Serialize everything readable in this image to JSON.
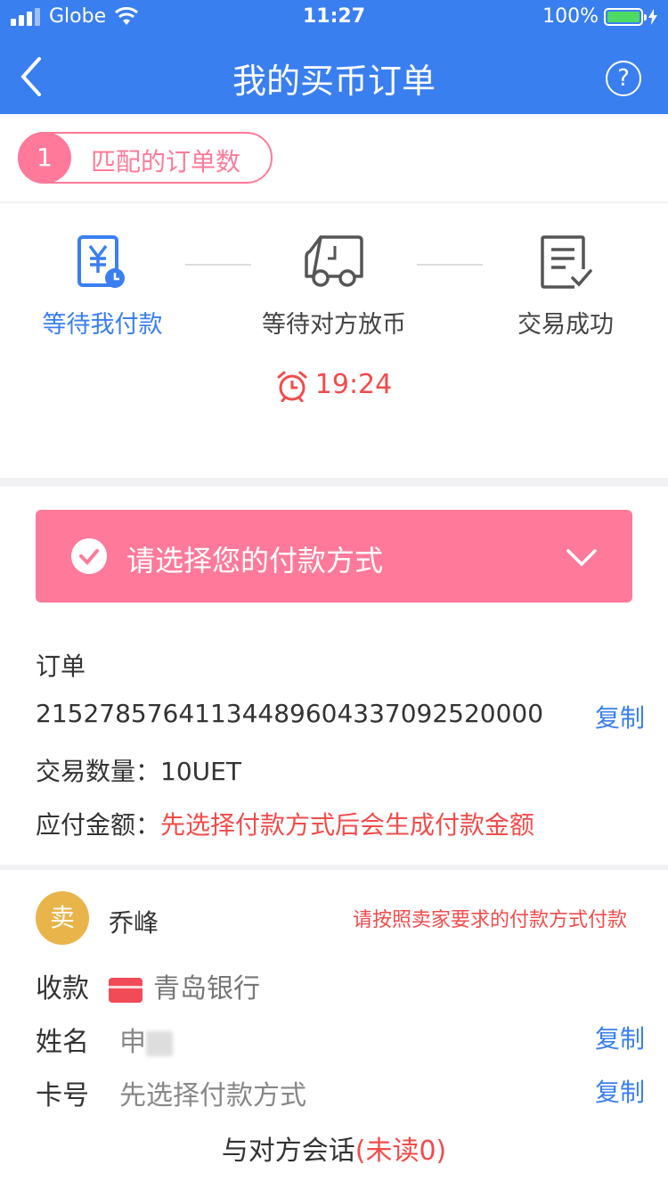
{
  "status_bar": {
    "carrier": "Globe",
    "time": "11:27",
    "battery": "100%"
  },
  "navbar": {
    "title": "我的买币订单",
    "help": "?"
  },
  "match": {
    "count": "1",
    "label": "匹配的订单数"
  },
  "steps": [
    {
      "label": "等待我付款",
      "icon": "yen-clock-icon",
      "active": true
    },
    {
      "label": "等待对方放币",
      "icon": "truck-icon",
      "active": false
    },
    {
      "label": "交易成功",
      "icon": "document-check-icon",
      "active": false
    }
  ],
  "timer": "19:24",
  "payment": {
    "label": "请选择您的付款方式"
  },
  "order": {
    "heading": "订单",
    "number": "21527857641134489604337092520000",
    "copy_label": "复制",
    "quantity_label": "交易数量：",
    "quantity_value": "10UET",
    "amount_label": "应付金额：",
    "amount_value": "先选择付款方式后会生成付款金额"
  },
  "seller": {
    "avatar_char": "卖",
    "name": "乔峰",
    "hint": "请按照卖家要求的付款方式付款",
    "receive_label": "收款",
    "bank": "青岛银行",
    "name_label": "姓名",
    "holder_name": "申",
    "card_label": "卡号",
    "card_value": "先选择付款方式",
    "copy_label": "复制"
  },
  "chat": {
    "label": "与对方会话",
    "unread": "(未读0)"
  },
  "colors": {
    "primary": "#3a7ff0",
    "pink": "#ff7a9a",
    "red": "#f24b4b",
    "avatar": "#e9b44a"
  }
}
